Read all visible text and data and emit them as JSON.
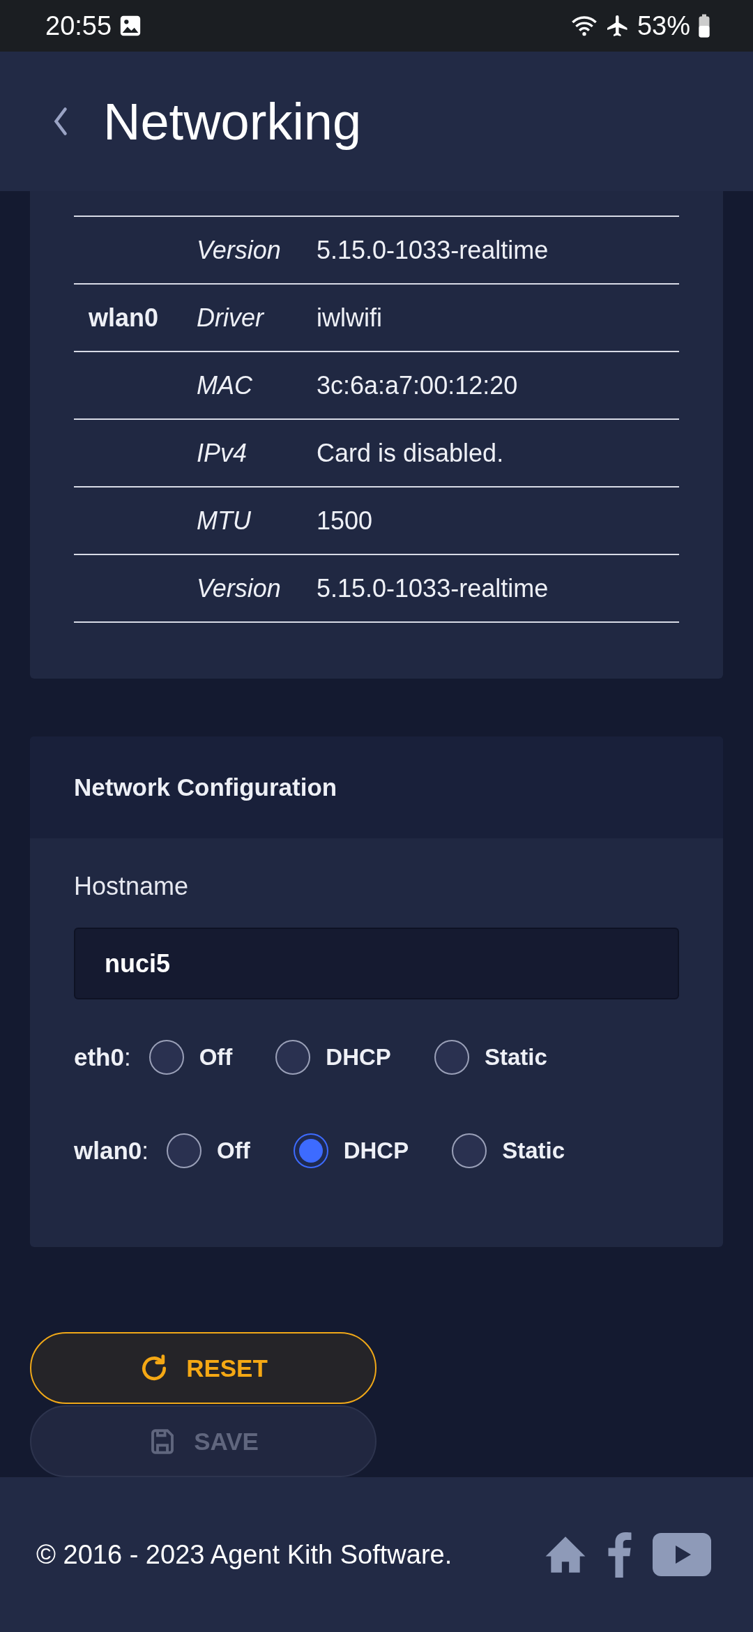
{
  "status_bar": {
    "time": "20:55",
    "battery": "53%"
  },
  "header": {
    "title": "Networking"
  },
  "interfaces_table": {
    "rows": [
      {
        "interface": "",
        "label": "Version",
        "value": "5.15.0-1033-realtime"
      },
      {
        "interface": "wlan0",
        "label": "Driver",
        "value": "iwlwifi"
      },
      {
        "interface": "",
        "label": "MAC",
        "value": "3c:6a:a7:00:12:20"
      },
      {
        "interface": "",
        "label": "IPv4",
        "value": "Card is disabled."
      },
      {
        "interface": "",
        "label": "MTU",
        "value": "1500"
      },
      {
        "interface": "",
        "label": "Version",
        "value": "5.15.0-1033-realtime"
      }
    ]
  },
  "network_configuration": {
    "title": "Network Configuration",
    "hostname": {
      "label": "Hostname",
      "value": "nuci5"
    },
    "modes": [
      {
        "interface": "eth0",
        "separator": ":",
        "options": [
          {
            "label": "Off",
            "selected": false
          },
          {
            "label": "DHCP",
            "selected": false
          },
          {
            "label": "Static",
            "selected": false
          }
        ]
      },
      {
        "interface": "wlan0",
        "separator": ":",
        "options": [
          {
            "label": "Off",
            "selected": false
          },
          {
            "label": "DHCP",
            "selected": true
          },
          {
            "label": "Static",
            "selected": false
          }
        ]
      }
    ]
  },
  "buttons": [
    {
      "kind": "reset",
      "label": "RESET",
      "disabled": false
    },
    {
      "kind": "save",
      "label": "SAVE",
      "disabled": true
    }
  ],
  "footer": {
    "copyright": "© 2016 - 2023 Agent Kith Software."
  }
}
